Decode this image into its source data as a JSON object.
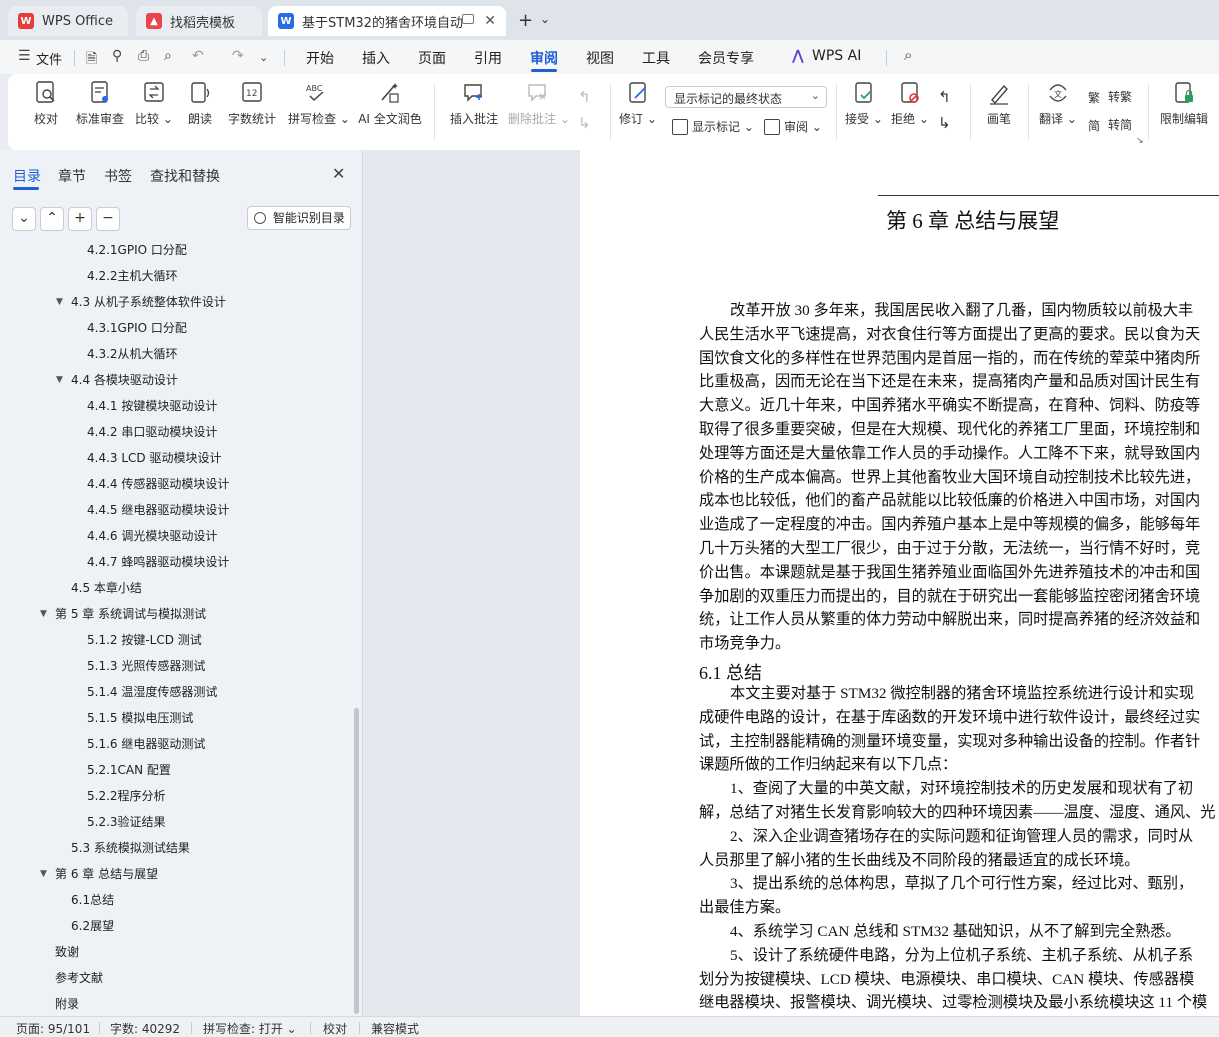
{
  "tabs": [
    {
      "label": "WPS Office"
    },
    {
      "label": "找稻壳模板"
    },
    {
      "label": "基于STM32的猪舍环境自动监"
    }
  ],
  "menu": {
    "file": "文件",
    "items": [
      "开始",
      "插入",
      "页面",
      "引用",
      "审阅",
      "视图",
      "工具",
      "会员专享"
    ],
    "active": "审阅",
    "ai": "WPS AI"
  },
  "ribbon": {
    "proofread": "校对",
    "std_review": "标准审查",
    "compare": "比较",
    "read_aloud": "朗读",
    "word_count": "字数统计",
    "spell_check": "拼写检查",
    "ai_proof": "AI 全文润色",
    "insert_comment": "插入批注",
    "delete_comment": "删除批注",
    "revise": "修订",
    "display_markup": "显示标记",
    "review": "审阅",
    "markup_mode": "显示标记的最终状态",
    "accept": "接受",
    "reject": "拒绝",
    "pen": "画笔",
    "translate": "翻译",
    "to_traditional": "转繁",
    "to_simplified": "转简",
    "restrict_edit": "限制编辑"
  },
  "nav": {
    "tabs": [
      "目录",
      "章节",
      "书签",
      "查找和替换"
    ],
    "smart_toc": "智能识别目录",
    "toc": [
      {
        "text": "4.2.1GPIO 口分配",
        "level": 3
      },
      {
        "text": "4.2.2主机大循环",
        "level": 3
      },
      {
        "text": "4.3  从机子系统整体软件设计",
        "level": 2,
        "expanded": true
      },
      {
        "text": "4.3.1GPIO 口分配",
        "level": 3
      },
      {
        "text": "4.3.2从机大循环",
        "level": 3
      },
      {
        "text": "4.4  各模块驱动设计",
        "level": 2,
        "expanded": true
      },
      {
        "text": "4.4.1 按键模块驱动设计",
        "level": 3
      },
      {
        "text": "4.4.2 串口驱动模块设计",
        "level": 3
      },
      {
        "text": "4.4.3 LCD 驱动模块设计",
        "level": 3
      },
      {
        "text": "4.4.4 传感器驱动模块设计",
        "level": 3
      },
      {
        "text": "4.4.5 继电器驱动模块设计",
        "level": 3
      },
      {
        "text": "4.4.6 调光模块驱动设计",
        "level": 3
      },
      {
        "text": "4.4.7 蜂鸣器驱动模块设计",
        "level": 3
      },
      {
        "text": "4.5  本章小结",
        "level": 2
      },
      {
        "text": "第 5 章  系统调试与模拟测试",
        "level": 1,
        "expanded": true
      },
      {
        "text": "5.1.2 按键-LCD 测试",
        "level": 3
      },
      {
        "text": "5.1.3 光照传感器测试",
        "level": 3
      },
      {
        "text": "5.1.4 温湿度传感器测试",
        "level": 3
      },
      {
        "text": "5.1.5 模拟电压测试",
        "level": 3
      },
      {
        "text": "5.1.6 继电器驱动测试",
        "level": 3
      },
      {
        "text": "5.2.1CAN 配置",
        "level": 3
      },
      {
        "text": "5.2.2程序分析",
        "level": 3
      },
      {
        "text": "5.2.3验证结果",
        "level": 3
      },
      {
        "text": "5.3  系统模拟测试结果",
        "level": 2
      },
      {
        "text": "第 6 章  总结与展望",
        "level": 1,
        "expanded": true
      },
      {
        "text": "6.1总结",
        "level": 2
      },
      {
        "text": "6.2展望",
        "level": 2
      },
      {
        "text": "致谢",
        "level": 1
      },
      {
        "text": "参考文献",
        "level": 1
      },
      {
        "text": "附录",
        "level": 1
      }
    ]
  },
  "document": {
    "chapter_title": "第 6 章  总结与展望",
    "para1": [
      "改革开放 30 多年来，我国居民收入翻了几番，国内物质较以前极大丰",
      "人民生活水平飞速提高，对衣食住行等方面提出了更高的要求。民以食为天",
      "国饮食文化的多样性在世界范围内是首屈一指的，而在传统的荤菜中猪肉所",
      "比重极高，因而无论在当下还是在未来，提高猪肉产量和品质对国计民生有",
      "大意义。近几十年来，中国养猪水平确实不断提高，在育种、饲料、防疫等",
      "取得了很多重要突破，但是在大规模、现代化的养猪工厂里面，环境控制和",
      "处理等方面还是大量依靠工作人员的手动操作。人工降不下来，就导致国内",
      "价格的生产成本偏高。世界上其他畜牧业大国环境自动控制技术比较先进，",
      "成本也比较低，他们的畜产品就能以比较低廉的价格进入中国市场，对国内",
      "业造成了一定程度的冲击。国内养殖户基本上是中等规模的偏多，能够每年",
      "几十万头猪的大型工厂很少，由于过于分散，无法统一，当行情不好时，竞",
      "价出售。本课题就是基于我国生猪养殖业面临国外先进养殖技术的冲击和国",
      "争加剧的双重压力而提出的，目的就在于研究出一套能够监控密闭猪舍环境",
      "统，让工作人员从繁重的体力劳动中解脱出来，同时提高养猪的经济效益和",
      "市场竞争力。"
    ],
    "section_title": "6.1  总结",
    "para2": [
      "本文主要对基于 STM32 微控制器的猪舍环境监控系统进行设计和实现",
      "成硬件电路的设计，在基于库函数的开发环境中进行软件设计，最终经过实",
      "试，主控制器能精确的测量环境变量，实现对多种输出设备的控制。作者针",
      "课题所做的工作归纳起来有以下几点："
    ],
    "item1": [
      "1、查阅了大量的中英文献，对环境控制技术的历史发展和现状有了初",
      "解，总结了对猪生长发育影响较大的四种环境因素——温度、湿度、通风、光"
    ],
    "item2": [
      "2、深入企业调查猪场存在的实际问题和征询管理人员的需求，同时从",
      "人员那里了解小猪的生长曲线及不同阶段的猪最适宜的成长环境。"
    ],
    "item3": [
      "3、提出系统的总体构思，草拟了几个可行性方案，经过比对、甄别，",
      "出最佳方案。"
    ],
    "item4": [
      "4、系统学习 CAN 总线和 STM32 基础知识，从不了解到完全熟悉。"
    ],
    "item5": [
      "5、设计了系统硬件电路，分为上位机子系统、主机子系统、从机子系",
      "划分为按键模块、LCD  模块、电源模块、串口模块、CAN  模块、传感器模",
      "继电器模块、报警模块、调光模块、过零检测模块及最小系统模块这 11 个模"
    ]
  },
  "status": {
    "page": "页面: 95/101",
    "words": "字数: 40292",
    "spell": "拼写检查: 打开",
    "proof": "校对",
    "compat": "兼容模式"
  }
}
